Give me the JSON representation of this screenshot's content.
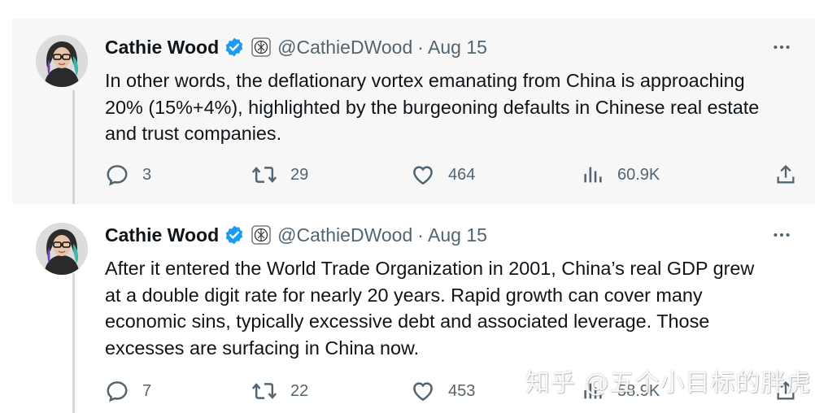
{
  "tweets": [
    {
      "author_name": "Cathie Wood",
      "handle": "@CathieDWood",
      "date": "· Aug 15",
      "text": "In other words, the deflationary vortex emanating from China is approaching 20% (15%+4%), highlighted by the burgeoning defaults in Chinese real estate and trust companies.",
      "replies": "3",
      "retweets": "29",
      "likes": "464",
      "views": "60.9K"
    },
    {
      "author_name": "Cathie Wood",
      "handle": "@CathieDWood",
      "date": "· Aug 15",
      "text": "After it entered the World Trade Organization in 2001, China’s real GDP grew at a double digit rate for nearly 20 years. Rapid growth can cover many economic sins, typically excessive debt and associated leverage. Those excesses are surfacing in China now.",
      "replies": "7",
      "retweets": "22",
      "likes": "453",
      "views": "58.9K"
    }
  ],
  "watermark": "知乎 @五个小目标的胖虎",
  "icons": {
    "verified": "verified-badge-icon",
    "affiliate": "affiliate-logo-icon",
    "more": "more-options-icon",
    "reply": "reply-icon",
    "retweet": "retweet-icon",
    "like": "heart-icon",
    "views": "views-chart-icon",
    "share": "share-icon"
  },
  "colors": {
    "verified_blue": "#1d9bf0",
    "muted_text": "#536471",
    "thread_line": "#cfd9de"
  }
}
